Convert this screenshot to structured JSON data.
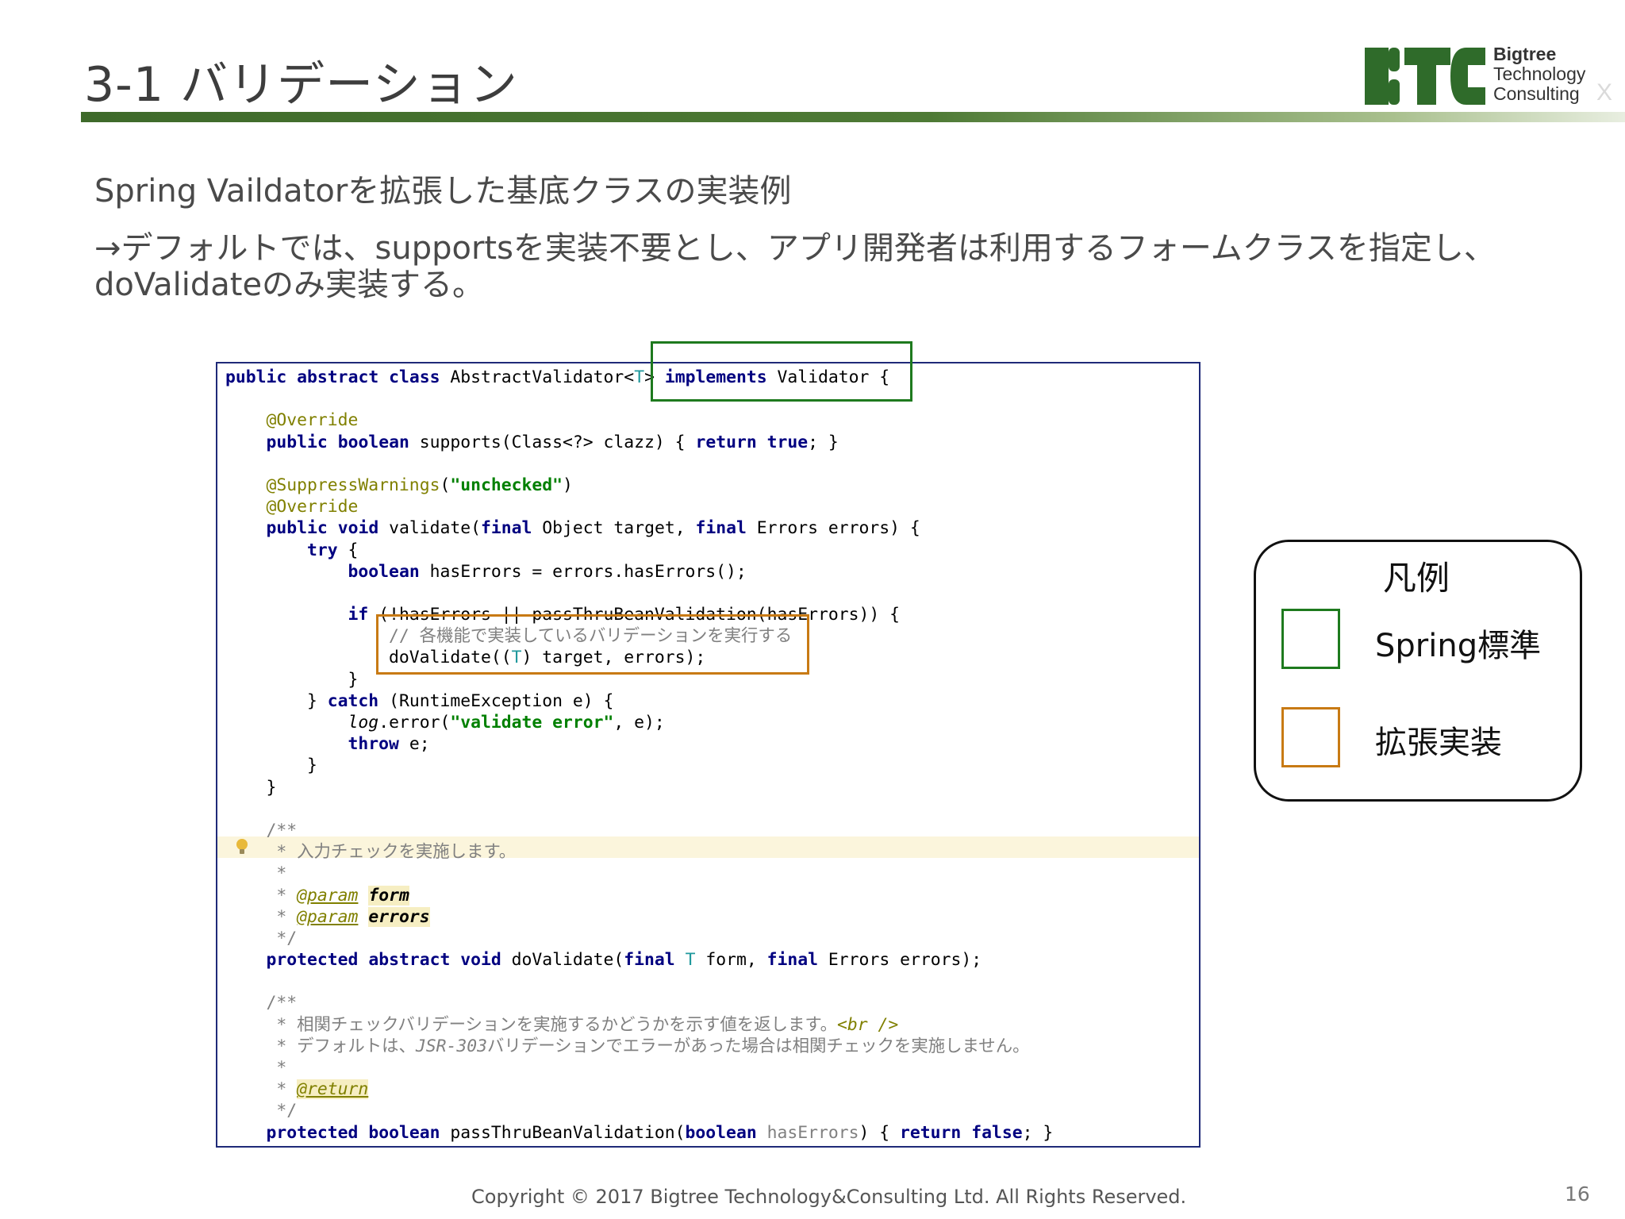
{
  "slide": {
    "title": "3-1 バリデーション",
    "subtitle": "Spring Vaildatorを拡張した基底クラスの実装例",
    "description_lines": [
      "→デフォルトでは、supportsを実装不要とし、アプリ開発者は利用するフォームクラスを指定し、",
      "doValidateのみ実装する。"
    ],
    "copyright": "Copyright © 2017 Bigtree Technology&Consulting Ltd. All Rights Reserved.",
    "page_number": "16"
  },
  "logo": {
    "lines": [
      "Bigtree",
      "Technology",
      "Consulting"
    ],
    "suffix": "X",
    "colors": {
      "mark": "#2f6b2a"
    }
  },
  "code": {
    "lines": [
      "public abstract class AbstractValidator<T> implements Validator {",
      "",
      "    @Override",
      "    public boolean supports(Class<?> clazz) { return true; }",
      "",
      "    @SuppressWarnings(\"unchecked\")",
      "    @Override",
      "    public void validate(final Object target, final Errors errors) {",
      "        try {",
      "            boolean hasErrors = errors.hasErrors();",
      "",
      "            if (!hasErrors || passThruBeanValidation(hasErrors)) {",
      "                // 各機能で実装しているバリデーションを実行する",
      "                doValidate((T) target, errors);",
      "            }",
      "        } catch (RuntimeException e) {",
      "            log.error(\"validate error\", e);",
      "            throw e;",
      "        }",
      "    }",
      "",
      "    /**",
      "     * 入力チェックを実施します。",
      "     *",
      "     * @param form",
      "     * @param errors",
      "     */",
      "    protected abstract void doValidate(final T form, final Errors errors);",
      "",
      "    /**",
      "     * 相関チェックバリデーションを実施するかどうかを示す値を返します。<br />",
      "     * デフォルトは、JSR-303バリデーションでエラーがあった場合は相関チェックを実施しません。",
      "     *",
      "     * @return",
      "     */",
      "    protected boolean passThruBeanValidation(boolean hasErrors) { return false; }"
    ]
  },
  "legend": {
    "title": "凡例",
    "items": [
      {
        "label": "Spring標準",
        "color": "#1e7a1e"
      },
      {
        "label": "拡張実装",
        "color": "#c87a14"
      }
    ]
  }
}
